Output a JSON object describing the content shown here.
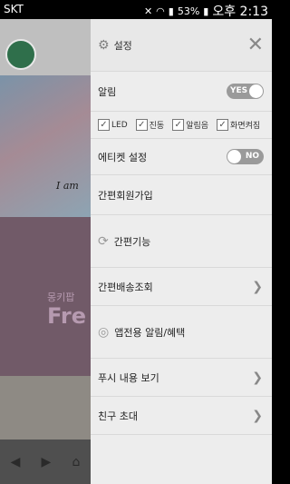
{
  "status_bar": {
    "carrier": "SKT",
    "battery": "53%",
    "time": "오후 2:13"
  },
  "drawer": {
    "title": "설정",
    "notification": {
      "label": "알림",
      "toggle": "YES"
    },
    "options": [
      "LED",
      "진동",
      "알림음",
      "화면켜짐"
    ],
    "etiquette": {
      "label": "에티켓 설정",
      "toggle": "NO"
    },
    "simple_signup": "간편회원가입",
    "simple_function": "간편기능",
    "delivery_lookup": "간편배송조회",
    "app_alerts": "앱전용 알림/혜택",
    "push_view": "푸시 내용 보기",
    "invite": "친구 초대"
  },
  "background": {
    "hero_text": "I am",
    "promo_small": "몽키팝",
    "promo_big": "Fre"
  }
}
